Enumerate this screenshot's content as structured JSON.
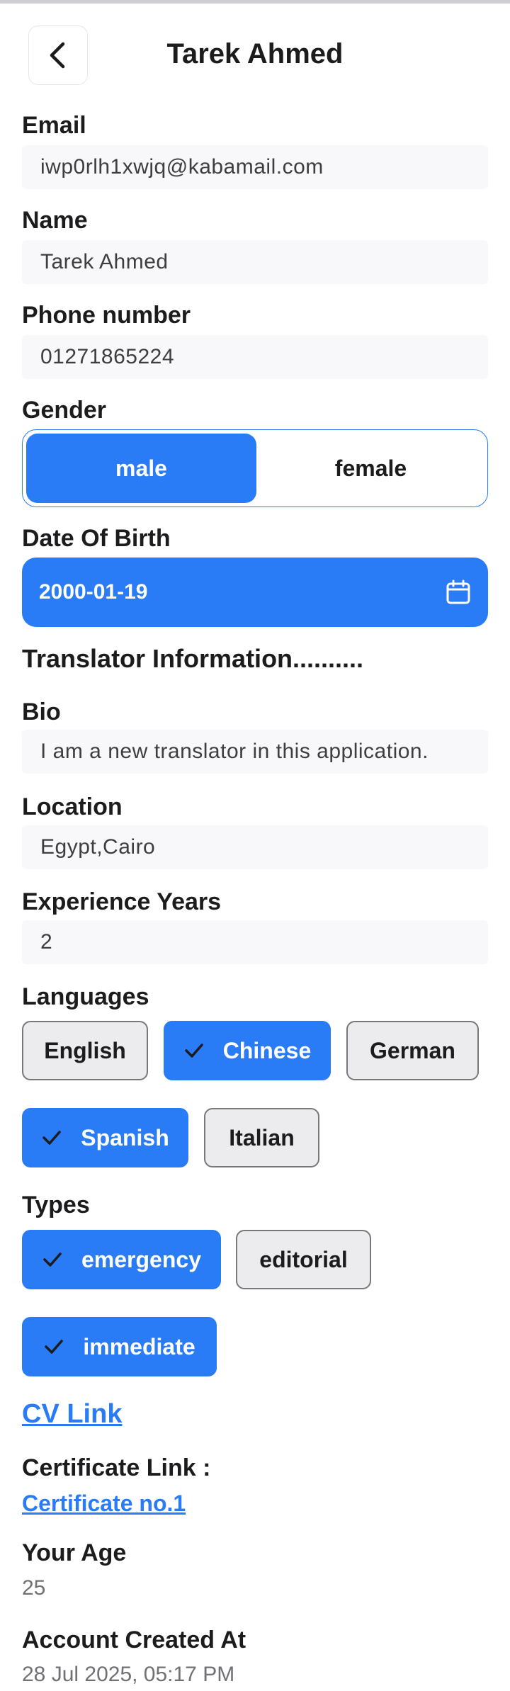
{
  "header": {
    "title": "Tarek Ahmed",
    "back_icon": "chevron-left-icon"
  },
  "email": {
    "label": "Email",
    "value": "iwp0rlh1xwjq@kabamail.com"
  },
  "name": {
    "label": "Name",
    "value": "Tarek Ahmed"
  },
  "phone": {
    "label": "Phone number",
    "value": "01271865224"
  },
  "gender": {
    "label": "Gender",
    "options": [
      "male",
      "female"
    ],
    "selected": "male"
  },
  "dob": {
    "label": "Date Of Birth",
    "value": "2000-01-19",
    "icon": "calendar-icon"
  },
  "translator": {
    "section_title": "Translator Information.........."
  },
  "bio": {
    "label": "Bio",
    "value": "I am a new translator in this application."
  },
  "location": {
    "label": "Location",
    "value": "Egypt,Cairo"
  },
  "experience": {
    "label": "Experience Years",
    "value": "2"
  },
  "languages": {
    "label": "Languages",
    "items": [
      {
        "label": "English",
        "selected": false
      },
      {
        "label": "Chinese",
        "selected": true
      },
      {
        "label": "German",
        "selected": false
      },
      {
        "label": "Spanish",
        "selected": true
      },
      {
        "label": "Italian",
        "selected": false
      }
    ]
  },
  "types": {
    "label": "Types",
    "items": [
      {
        "label": "emergency",
        "selected": true
      },
      {
        "label": "editorial",
        "selected": false
      },
      {
        "label": "immediate",
        "selected": true
      }
    ]
  },
  "cv": {
    "link_label": "CV Link"
  },
  "certificate": {
    "label": "Certificate Link :",
    "link_label": "Certificate no.1"
  },
  "age": {
    "label": "Your Age",
    "value": "25"
  },
  "created": {
    "label": "Account Created At",
    "value": "28 Jul 2025, 05:17 PM"
  },
  "colors": {
    "accent": "#2a7bf6",
    "chip_off_bg": "#ececee",
    "field_bg": "#f8f8fa"
  }
}
